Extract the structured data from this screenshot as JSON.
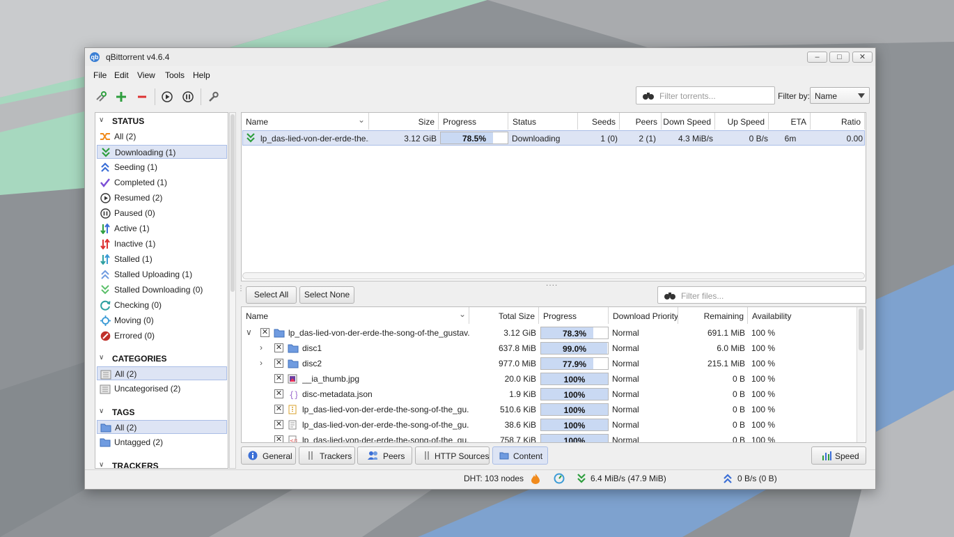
{
  "window": {
    "title": "qBittorrent v4.6.4",
    "minimize": "–",
    "maximize": "□",
    "close": "✕"
  },
  "menu": [
    "File",
    "Edit",
    "View",
    "Tools",
    "Help"
  ],
  "toolbar": {
    "search_placeholder": "Filter torrents...",
    "filter_by_label": "Filter by:",
    "filter_by_value": "Name",
    "icons": [
      "add-link-icon",
      "add-torrent-icon",
      "remove-icon",
      "resume-icon",
      "pause-icon",
      "options-icon"
    ]
  },
  "sidebar": {
    "status_title": "STATUS",
    "status_items": [
      {
        "label": "All (2)",
        "icon": "shuffle-icon"
      },
      {
        "label": "Downloading (1)",
        "icon": "downloading-icon"
      },
      {
        "label": "Seeding (1)",
        "icon": "seeding-icon"
      },
      {
        "label": "Completed (1)",
        "icon": "checkmark-icon"
      },
      {
        "label": "Resumed (2)",
        "icon": "resumed-icon"
      },
      {
        "label": "Paused (0)",
        "icon": "paused-icon"
      },
      {
        "label": "Active (1)",
        "icon": "active-icon"
      },
      {
        "label": "Inactive (1)",
        "icon": "inactive-icon"
      },
      {
        "label": "Stalled (1)",
        "icon": "stalled-icon"
      },
      {
        "label": "Stalled Uploading (1)",
        "icon": "stalled-uploading-icon"
      },
      {
        "label": "Stalled Downloading (0)",
        "icon": "stalled-downloading-icon"
      },
      {
        "label": "Checking (0)",
        "icon": "checking-icon"
      },
      {
        "label": "Moving (0)",
        "icon": "moving-icon"
      },
      {
        "label": "Errored (0)",
        "icon": "errored-icon"
      }
    ],
    "categories_title": "CATEGORIES",
    "categories": [
      {
        "label": "All (2)"
      },
      {
        "label": "Uncategorised (2)"
      }
    ],
    "tags_title": "TAGS",
    "tags": [
      {
        "label": "All (2)"
      },
      {
        "label": "Untagged (2)"
      }
    ],
    "trackers_title": "TRACKERS"
  },
  "torrent_list": {
    "columns": [
      "Name",
      "Size",
      "Progress",
      "Status",
      "Seeds",
      "Peers",
      "Down Speed",
      "Up Speed",
      "ETA",
      "Ratio"
    ],
    "rows": [
      {
        "name": "lp_das-lied-von-der-erde-the...",
        "size": "3.12 GiB",
        "progress": "78.5%",
        "progress_fraction": 0.785,
        "status": "Downloading",
        "seeds": "1 (0)",
        "peers": "2 (1)",
        "down_speed": "4.3 MiB/s",
        "up_speed": "0 B/s",
        "eta": "6m",
        "ratio": "0.00"
      }
    ]
  },
  "content": {
    "select_all": "Select All",
    "select_none": "Select None",
    "filter_placeholder": "Filter files...",
    "columns": [
      "Name",
      "Total Size",
      "Progress",
      "Download Priority",
      "Remaining",
      "Availability"
    ],
    "rows": [
      {
        "expander": "∨",
        "type": "folder",
        "name": "lp_das-lied-von-der-erde-the-song-of-the_gustav...",
        "size": "3.12 GiB",
        "progress": "78.3%",
        "progress_fraction": 0.783,
        "priority": "Normal",
        "remaining": "691.1 MiB",
        "availability": "100 %"
      },
      {
        "expander": "›",
        "type": "folder",
        "name": "disc1",
        "size": "637.8 MiB",
        "progress": "99.0%",
        "progress_fraction": 0.99,
        "priority": "Normal",
        "remaining": "6.0 MiB",
        "availability": "100 %"
      },
      {
        "expander": "›",
        "type": "folder",
        "name": "disc2",
        "size": "977.0 MiB",
        "progress": "77.9%",
        "progress_fraction": 0.779,
        "priority": "Normal",
        "remaining": "215.1 MiB",
        "availability": "100 %"
      },
      {
        "expander": "",
        "type": "image",
        "name": "__ia_thumb.jpg",
        "size": "20.0 KiB",
        "progress": "100%",
        "progress_fraction": 1.0,
        "priority": "Normal",
        "remaining": "0 B",
        "availability": "100 %"
      },
      {
        "expander": "",
        "type": "json",
        "name": "disc-metadata.json",
        "size": "1.9 KiB",
        "progress": "100%",
        "progress_fraction": 1.0,
        "priority": "Normal",
        "remaining": "0 B",
        "availability": "100 %"
      },
      {
        "expander": "",
        "type": "archive",
        "name": "lp_das-lied-von-der-erde-the-song-of-the_gu...",
        "size": "510.6 KiB",
        "progress": "100%",
        "progress_fraction": 1.0,
        "priority": "Normal",
        "remaining": "0 B",
        "availability": "100 %"
      },
      {
        "expander": "",
        "type": "text",
        "name": "lp_das-lied-von-der-erde-the-song-of-the_gu...",
        "size": "38.6 KiB",
        "progress": "100%",
        "progress_fraction": 1.0,
        "priority": "Normal",
        "remaining": "0 B",
        "availability": "100 %"
      },
      {
        "expander": "",
        "type": "xml",
        "name": "lp_das-lied-von-der-erde-the-song-of-the_gu...",
        "size": "758.7 KiB",
        "progress": "100%",
        "progress_fraction": 1.0,
        "priority": "Normal",
        "remaining": "0 B",
        "availability": "100 %"
      }
    ]
  },
  "tabs": [
    {
      "label": "General",
      "icon": "info-icon"
    },
    {
      "label": "Trackers",
      "icon": "trackers-icon"
    },
    {
      "label": "Peers",
      "icon": "peers-icon"
    },
    {
      "label": "HTTP Sources",
      "icon": "http-sources-icon"
    },
    {
      "label": "Content",
      "icon": "content-icon"
    }
  ],
  "selected_tab": "Content",
  "speed_button": "Speed",
  "statusbar": {
    "dht": "DHT: 103 nodes",
    "download": "6.4 MiB/s (47.9 MiB)",
    "upload": "0 B/s (0 B)"
  },
  "colors": {
    "accent_selection": "#dde4f4",
    "download_green": "#2e9e3e",
    "upload_blue": "#3b6fd6",
    "progress_fill": "#c9d9f3"
  }
}
